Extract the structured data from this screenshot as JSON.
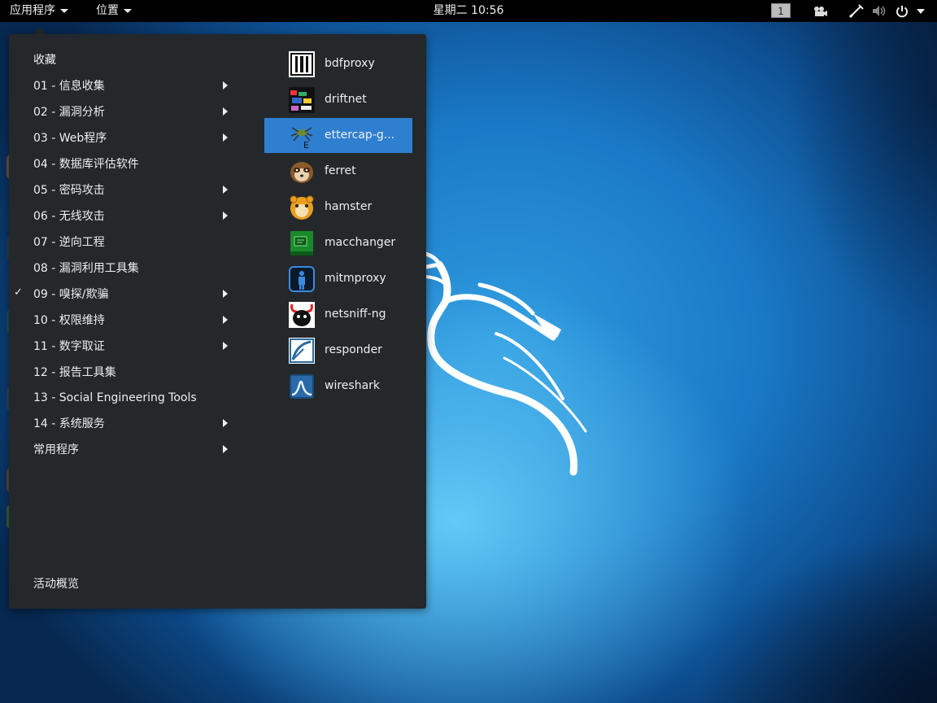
{
  "topbar": {
    "apps_menu": "应用程序",
    "places_menu": "位置",
    "clock": "星期二 10:56",
    "workspace": "1",
    "icons": [
      "video-icon",
      "network-icon",
      "volume-icon",
      "power-icon",
      "chevron-down-icon"
    ]
  },
  "menu": {
    "favorites": "收藏",
    "categories": [
      {
        "label": "01 - 信息收集",
        "submenu": true
      },
      {
        "label": "02 - 漏洞分析",
        "submenu": true
      },
      {
        "label": "03 - Web程序",
        "submenu": true
      },
      {
        "label": "04 - 数据库评估软件",
        "submenu": false
      },
      {
        "label": "05 - 密码攻击",
        "submenu": true
      },
      {
        "label": "06 - 无线攻击",
        "submenu": true
      },
      {
        "label": "07 - 逆向工程",
        "submenu": false
      },
      {
        "label": "08 - 漏洞利用工具集",
        "submenu": false
      },
      {
        "label": "09 - 嗅探/欺骗",
        "submenu": true,
        "checked": true,
        "check_mark": "✓"
      },
      {
        "label": "10 - 权限维持",
        "submenu": true
      },
      {
        "label": "11 - 数字取证",
        "submenu": true
      },
      {
        "label": "12 - 报告工具集",
        "submenu": false
      },
      {
        "label": "13 - Social Engineering Tools",
        "submenu": false
      },
      {
        "label": "14 - 系统服务",
        "submenu": true
      },
      {
        "label": "常用程序",
        "submenu": true
      }
    ],
    "activities": "活动概览",
    "apps": [
      {
        "label": "bdfproxy",
        "icon": "bdfproxy-icon"
      },
      {
        "label": "driftnet",
        "icon": "driftnet-icon"
      },
      {
        "label": "ettercap-g...",
        "icon": "ettercap-icon",
        "selected": true
      },
      {
        "label": "ferret",
        "icon": "ferret-icon"
      },
      {
        "label": "hamster",
        "icon": "hamster-icon"
      },
      {
        "label": "macchanger",
        "icon": "macchanger-icon"
      },
      {
        "label": "mitmproxy",
        "icon": "mitmproxy-icon"
      },
      {
        "label": "netsniff-ng",
        "icon": "netsniff-ng-icon"
      },
      {
        "label": "responder",
        "icon": "responder-icon"
      },
      {
        "label": "wireshark",
        "icon": "wireshark-icon"
      }
    ],
    "selection_color": "#2f7fd1"
  }
}
